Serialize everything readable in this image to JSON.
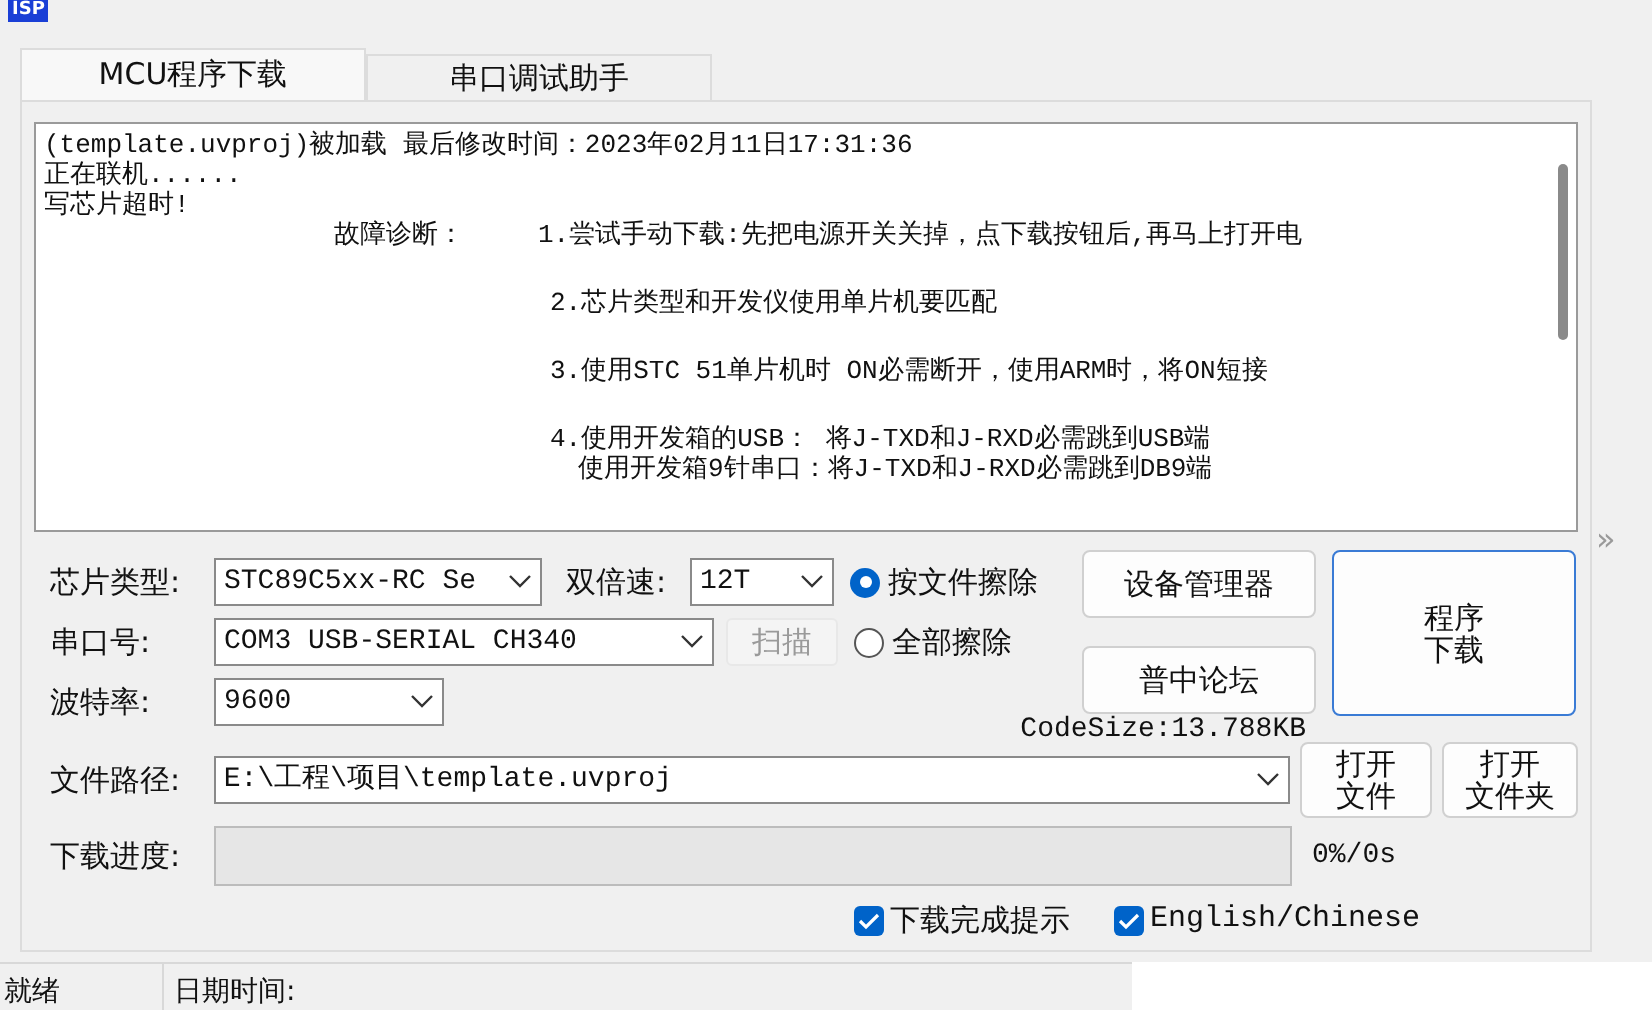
{
  "window": {
    "icon": "ISP"
  },
  "tabs": [
    {
      "label": "MCU程序下载",
      "selected": true
    },
    {
      "label": "串口调试助手",
      "selected": false
    }
  ],
  "log": {
    "messages": [
      "(template.uvproj)被加载 最后修改时间：2023年02月11日17:31:36",
      "正在联机......",
      "写芯片超时!"
    ],
    "diagnosis_label": "故障诊断：",
    "diagnosis_items": [
      {
        "lines": [
          "1.尝试手动下载:先把电源开关关掉，点下载按钮后,再马上打开电"
        ]
      },
      {
        "lines": [
          "2.芯片类型和开发仪使用单片机要匹配"
        ]
      },
      {
        "lines": [
          "3.使用STC 51单片机时 ON必需断开，使用ARM时，将ON短接"
        ]
      },
      {
        "lines": [
          "4.使用开发箱的USB：   将J-TXD和J-RXD必需跳到USB端",
          "使用开发箱9针串口：将J-TXD和J-RXD必需跳到DB9端"
        ]
      }
    ]
  },
  "expand_toggle": "»",
  "chip_type": {
    "label": "芯片类型:",
    "value": "STC89C5xx-RC Se"
  },
  "double_speed": {
    "label": "双倍速:",
    "value": "12T"
  },
  "erase_options": [
    {
      "label": "按文件擦除",
      "selected": true
    },
    {
      "label": "全部擦除",
      "selected": false
    }
  ],
  "port": {
    "label": "串口号:",
    "value": "COM3  USB-SERIAL CH340"
  },
  "scan_button": {
    "label": "扫描",
    "disabled": true
  },
  "baud": {
    "label": "波特率:",
    "value": "9600"
  },
  "device_manager_button": "设备管理器",
  "forum_button": "普中论坛",
  "download_button": [
    "程序",
    "下载"
  ],
  "code_size": "CodeSize:13.788KB",
  "file_path": {
    "label": "文件路径:",
    "value": "E:\\工程\\项目\\template.uvproj"
  },
  "open_file_button": [
    "打开",
    "文件"
  ],
  "open_folder_button": [
    "打开",
    "文件夹"
  ],
  "progress": {
    "label": "下载进度:",
    "level": 0,
    "reading": "0%/0s"
  },
  "options": [
    {
      "label": "下载完成提示",
      "checked": true
    },
    {
      "label": "English/Chinese",
      "checked": true
    }
  ],
  "status_bar": {
    "status": "就绪",
    "datetime_label": "日期时间:"
  }
}
